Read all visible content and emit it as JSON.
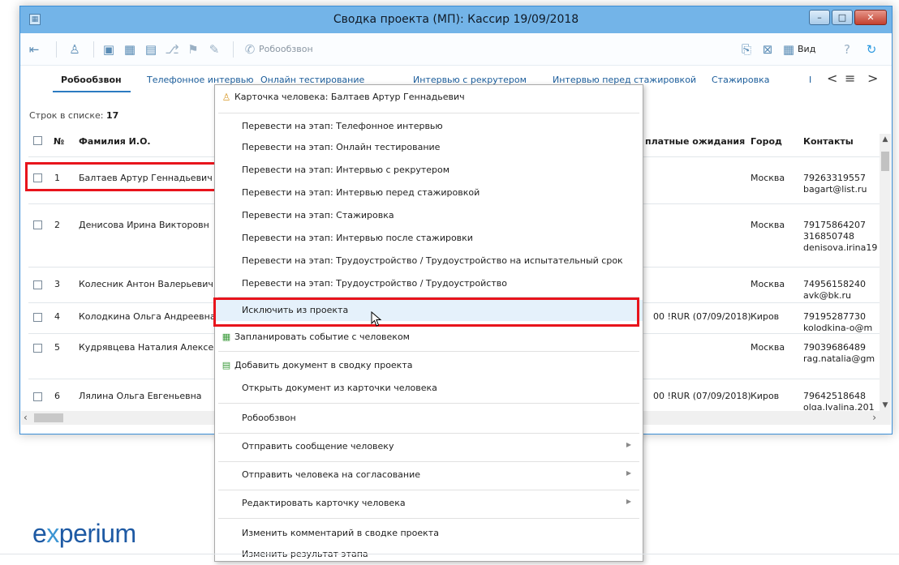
{
  "window": {
    "title": "Сводка проекта (МП): Кассир 19/09/2018"
  },
  "toolbar": {
    "robo_label": "Робообзвон",
    "view_label": "Вид"
  },
  "tabs": [
    {
      "label": "Робообзвон",
      "active": true
    },
    {
      "label": "Телефонное интервью"
    },
    {
      "label": "Онлайн тестирование"
    },
    {
      "label": "Интервью с рекрутером"
    },
    {
      "label": "Интервью перед стажировкой"
    },
    {
      "label": "Стажировка"
    }
  ],
  "list": {
    "count_label": "Строк в списке:",
    "count": "17"
  },
  "table": {
    "headers": {
      "num": "№",
      "name": "Фамилия И.О.",
      "salary": "платные ожидания",
      "city": "Город",
      "contacts": "Контакты"
    },
    "rows": [
      {
        "num": "1",
        "name": "Балтаев Артур Геннадьевич",
        "salary": "",
        "city": "Москва",
        "contact1": "79263319557",
        "contact2": "bagart@list.ru",
        "contact3": ""
      },
      {
        "num": "2",
        "name": "Денисова Ирина Викторовн",
        "salary": "",
        "city": "Москва",
        "contact1": "79175864207",
        "contact2": "316850748",
        "contact3": "denisova.irina19"
      },
      {
        "num": "3",
        "name": "Колесник Антон Валерьевич",
        "salary": "",
        "city": "Москва",
        "contact1": "74956158240",
        "contact2": "avk@bk.ru",
        "contact3": ""
      },
      {
        "num": "4",
        "name": "Колодкина Ольга Андреевна",
        "salary": "00 !RUR (07/09/2018)",
        "city": "Киров",
        "contact1": "79195287730",
        "contact2": "kolodkina-o@m",
        "contact3": ""
      },
      {
        "num": "5",
        "name": "Кудрявцева Наталия Алексе...",
        "salary": "",
        "city": "Москва",
        "contact1": "79039686489",
        "contact2": "rag.natalia@gm",
        "contact3": ""
      },
      {
        "num": "6",
        "name": "Лялина Ольга Евгеньевна",
        "salary": "00 !RUR (07/09/2018)",
        "city": "Киров",
        "contact1": "79642518648",
        "contact2": "olga.lyalina.201",
        "contact3": ""
      }
    ]
  },
  "context_menu": {
    "person_card": "Карточка человека: Балтаев Артур Геннадьевич",
    "move_items": [
      "Перевести на этап: Телефонное интервью",
      "Перевести на этап: Онлайн тестирование",
      "Перевести на этап: Интервью с рекрутером",
      "Перевести на этап: Интервью перед стажировкой",
      "Перевести на этап: Стажировка",
      "Перевести на этап: Интервью после стажировки",
      "Перевести на этап: Трудоустройство / Трудоустройство на испытательный срок",
      "Перевести на этап: Трудоустройство / Трудоустройство"
    ],
    "exclude": "Исключить из проекта",
    "plan_event": "Запланировать событие с человеком",
    "add_doc": "Добавить документ в сводку проекта",
    "open_doc": "Открыть документ из карточки человека",
    "robo": "Робообзвон",
    "send_message": "Отправить сообщение человеку",
    "send_approval": "Отправить человека на согласование",
    "edit_card": "Редактировать карточку человека",
    "edit_comment": "Изменить комментарий в сводке проекта",
    "edit_result": "Изменить результат этапа"
  },
  "brand": {
    "text_pre": "e",
    "text_x": "x",
    "text_post": "perium"
  }
}
